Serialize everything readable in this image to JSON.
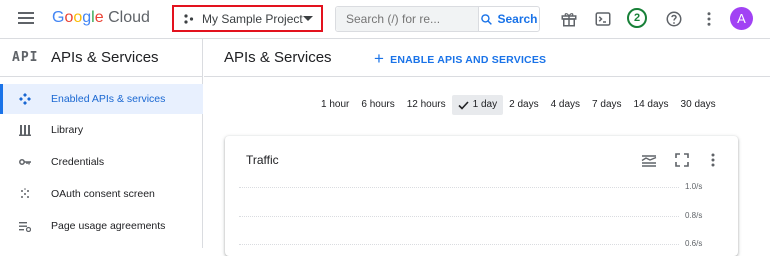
{
  "header": {
    "logo_google": "Google",
    "logo_cloud": "Cloud",
    "project": "My Sample Project",
    "search_placeholder": "Search (/) for re...",
    "search_button": "Search",
    "notifications_count": "2",
    "avatar_letter": "A"
  },
  "colors": {
    "accent": "#1a73e8",
    "highlight_border": "#e3121e",
    "avatar": "#a142f4",
    "badge": "#188038"
  },
  "sidebar": {
    "logo": "API",
    "title": "APIs & Services",
    "items": [
      {
        "label": "Enabled APIs & services",
        "icon": "enabled-apis-icon",
        "active": true
      },
      {
        "label": "Library",
        "icon": "library-icon"
      },
      {
        "label": "Credentials",
        "icon": "key-icon"
      },
      {
        "label": "OAuth consent screen",
        "icon": "oauth-consent-icon"
      },
      {
        "label": "Page usage agreements",
        "icon": "page-usage-icon"
      }
    ]
  },
  "main": {
    "title": "APIs & Services",
    "enable_button": "ENABLE APIS AND SERVICES",
    "time_ranges": [
      "1 hour",
      "6 hours",
      "12 hours",
      "1 day",
      "2 days",
      "4 days",
      "7 days",
      "14 days",
      "30 days"
    ],
    "selected_range": "1 day",
    "card": {
      "title": "Traffic",
      "y_ticks": [
        "1.0/s",
        "0.8/s",
        "0.6/s"
      ]
    }
  }
}
